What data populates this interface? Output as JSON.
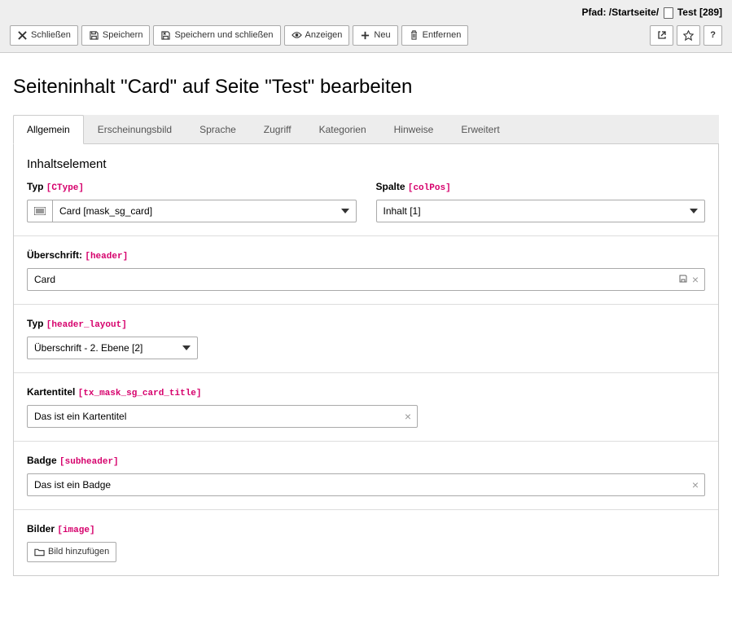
{
  "breadcrumb": {
    "prefix": "Pfad:",
    "root": "/Startseite/",
    "page": "Test",
    "id": "[289]"
  },
  "toolbar": {
    "close": "Schließen",
    "save": "Speichern",
    "save_close": "Speichern und schließen",
    "view": "Anzeigen",
    "new": "Neu",
    "delete": "Entfernen",
    "help": "?"
  },
  "page_title": "Seiteninhalt \"Card\" auf Seite \"Test\" bearbeiten",
  "tabs": [
    "Allgemein",
    "Erscheinungsbild",
    "Sprache",
    "Zugriff",
    "Kategorien",
    "Hinweise",
    "Erweitert"
  ],
  "section_title": "Inhaltselement",
  "fields": {
    "type": {
      "label": "Typ",
      "tech": "[CType]",
      "value": "Card [mask_sg_card]"
    },
    "column": {
      "label": "Spalte",
      "tech": "[colPos]",
      "value": "Inhalt [1]"
    },
    "header": {
      "label": "Überschrift:",
      "tech": "[header]",
      "value": "Card"
    },
    "header_layout": {
      "label": "Typ",
      "tech": "[header_layout]",
      "value": "Überschrift - 2. Ebene [2]"
    },
    "card_title": {
      "label": "Kartentitel",
      "tech": "[tx_mask_sg_card_title]",
      "value": "Das ist ein Kartentitel"
    },
    "badge": {
      "label": "Badge",
      "tech": "[subheader]",
      "value": "Das ist ein Badge"
    },
    "images": {
      "label": "Bilder",
      "tech": "[image]",
      "add_button": "Bild hinzufügen"
    }
  }
}
